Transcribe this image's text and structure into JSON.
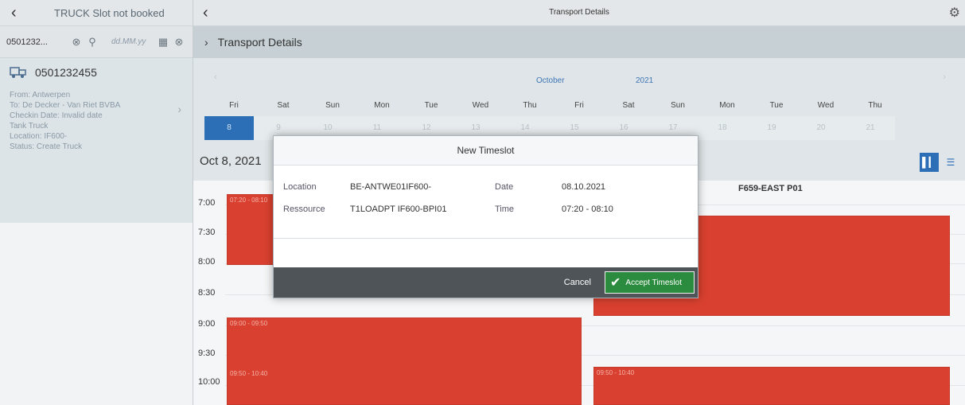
{
  "left": {
    "header_title": "TRUCK Slot not booked",
    "search_value": "0501232...",
    "date_placeholder": "dd.MM.yy",
    "truck": {
      "id": "0501232455",
      "from": "From: Antwerpen",
      "to": "To: De Decker - Van Riet BVBA",
      "checkin": "Checkin Date: Invalid date",
      "type": "Tank Truck",
      "location": "Location: IF600-",
      "status": "Status: Create Truck"
    }
  },
  "topbar": {
    "title": "Transport Details"
  },
  "subbar": {
    "title": "Transport Details"
  },
  "calendar": {
    "month": "October",
    "year": "2021",
    "days": [
      {
        "name": "Fri",
        "num": "8"
      },
      {
        "name": "Sat",
        "num": "9"
      },
      {
        "name": "Sun",
        "num": "10"
      },
      {
        "name": "Mon",
        "num": "11"
      },
      {
        "name": "Tue",
        "num": "12"
      },
      {
        "name": "Wed",
        "num": "13"
      },
      {
        "name": "Thu",
        "num": "14"
      },
      {
        "name": "Fri",
        "num": "15"
      },
      {
        "name": "Sat",
        "num": "16"
      },
      {
        "name": "Sun",
        "num": "17"
      },
      {
        "name": "Mon",
        "num": "18"
      },
      {
        "name": "Tue",
        "num": "19"
      },
      {
        "name": "Wed",
        "num": "20"
      },
      {
        "name": "Thu",
        "num": "21"
      }
    ],
    "selected_date": "Oct 8, 2021"
  },
  "schedule": {
    "column_header": "F659-EAST P01",
    "times": [
      "7:00",
      "7:30",
      "8:00",
      "8:30",
      "9:00",
      "9:30",
      "10:00"
    ],
    "slot_labels": [
      "07:20 - 08:10",
      "09:00 - 09:50",
      "09:50 - 10:40",
      "09:50 - 10:40"
    ]
  },
  "dialog": {
    "title": "New Timeslot",
    "location_label": "Location",
    "location_value": "BE-ANTWE01IF600-",
    "date_label": "Date",
    "date_value": "08.10.2021",
    "resource_label": "Ressource",
    "resource_value": "T1LOADPT IF600-BPI01",
    "time_label": "Time",
    "time_value": "07:20 - 08:10",
    "cancel_label": "Cancel",
    "accept_label": "Accept Timeslot"
  },
  "colors": {
    "accent": "#2d6fb7",
    "slot_red": "#d9402f",
    "accept_green": "#2b8b3e"
  }
}
